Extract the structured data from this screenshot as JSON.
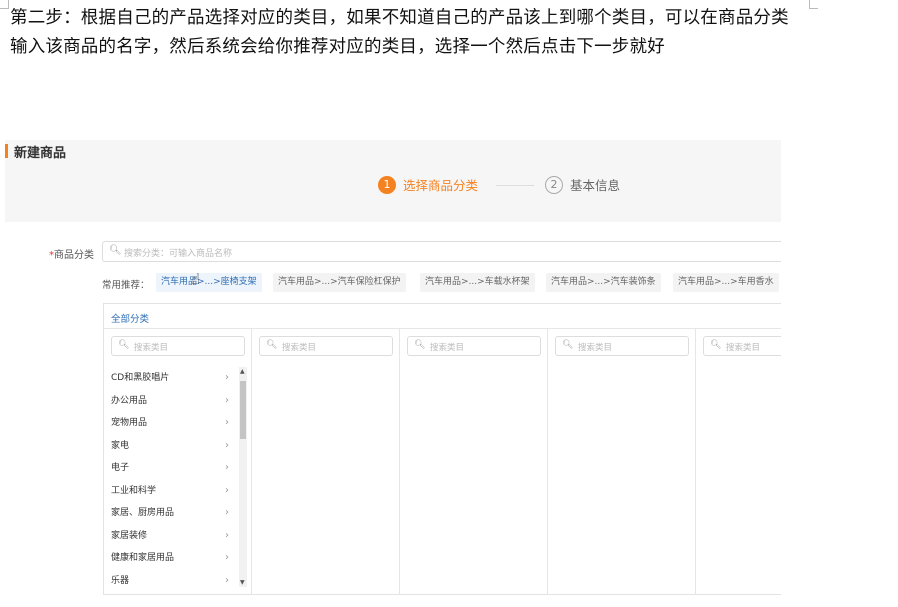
{
  "instruction": {
    "text": "第二步：根据自己的产品选择对应的类目，如果不知道自己的产品该上到哪个类目，可以在商品分类输入该商品的名字，然后系统会给你推荐对应的类目，选择一个然后点击下一步就好"
  },
  "screenshot": {
    "page_title": "新建商品",
    "steps": [
      {
        "num": "1",
        "label": "选择商品分类",
        "active": true
      },
      {
        "num": "2",
        "label": "基本信息",
        "active": false
      }
    ],
    "category_field": {
      "required_mark": "*",
      "label": "商品分类",
      "placeholder": "搜索分类：可输入商品名称"
    },
    "recommend_label": "常用推荐：",
    "recommendations": [
      "汽车用品>...>座椅支架",
      "汽车用品>...>汽车保险杠保护",
      "汽车用品>...>车载水杯架",
      "汽车用品>...>汽车装饰条",
      "汽车用品>...>车用香水"
    ],
    "all_categories_label": "全部分类",
    "column_search_placeholder": "搜索类目",
    "categories": [
      "CD和黑胶唱片",
      "办公用品",
      "宠物用品",
      "家电",
      "电子",
      "工业和科学",
      "家居、厨房用品",
      "家居装修",
      "健康和家居用品",
      "乐器"
    ],
    "accent_color": "#f58220",
    "link_color": "#2f6fb5"
  }
}
